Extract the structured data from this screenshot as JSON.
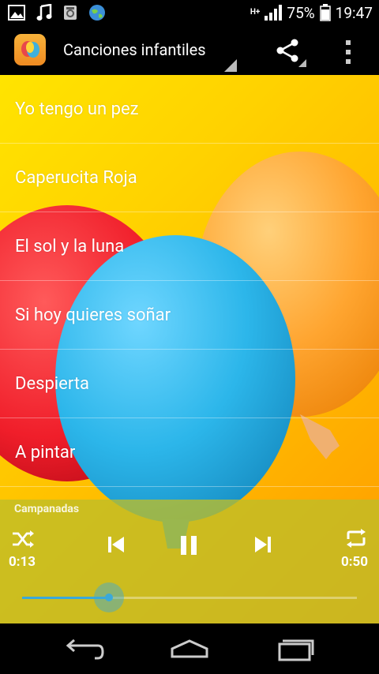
{
  "status_bar": {
    "network": "H+",
    "battery": "75%",
    "time": "19:47",
    "icons": [
      "gallery-icon",
      "music-note-icon",
      "storage-icon",
      "globe-icon"
    ]
  },
  "action_bar": {
    "title": "Canciones infantiles",
    "icons": [
      "app-balloon-icon",
      "share-icon",
      "overflow-menu-icon"
    ]
  },
  "songs": [
    {
      "label": "Yo tengo un pez"
    },
    {
      "label": "Caperucita Roja"
    },
    {
      "label": "El sol y la luna"
    },
    {
      "label": "Si hoy quieres soñar"
    },
    {
      "label": "Despierta"
    },
    {
      "label": "A pintar"
    }
  ],
  "player": {
    "now_playing": "Campanadas",
    "elapsed": "0:13",
    "total": "0:50",
    "progress": 0.26,
    "icons": [
      "shuffle-icon",
      "previous-icon",
      "pause-icon",
      "next-icon",
      "repeat-icon"
    ]
  },
  "nav_bar": {
    "icons": [
      "back-icon",
      "home-icon",
      "recents-icon"
    ]
  },
  "colors": {
    "accent": "#3aa9d9",
    "background_top": "#ffe400",
    "background_bottom": "#ff9a00",
    "player_panel": "#bebe28"
  }
}
